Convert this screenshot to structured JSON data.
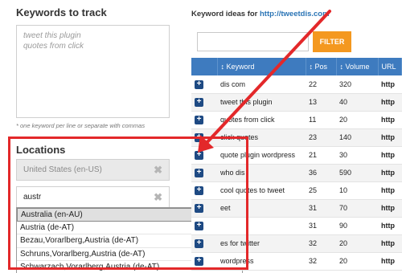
{
  "keywords": {
    "title": "Keywords to track",
    "textarea_value": "tweet this plugin\nquotes from click",
    "hint": "* one keyword per line or separate with commas"
  },
  "locations": {
    "title": "Locations",
    "selected": "United States (en-US)",
    "search_value": "austr",
    "options": [
      "Australia (en-AU)",
      "Austria (de-AT)",
      "Bezau,Vorarlberg,Austria (de-AT)",
      "Schruns,Vorarlberg,Austria (de-AT)",
      "Schwarzach,Vorarlberg,Austria (de-AT)"
    ]
  },
  "ideas": {
    "title_prefix": "Keyword ideas for",
    "site": "http://tweetdis.com",
    "filter_label": "FILTER",
    "columns": [
      "↕ Keyword",
      "↕ Pos",
      "↕ Volume",
      "URL"
    ],
    "rows": [
      {
        "keyword": "dis com",
        "pos": "22",
        "volume": "320",
        "url": "http"
      },
      {
        "keyword": "tweet this plugin",
        "pos": "13",
        "volume": "40",
        "url": "http"
      },
      {
        "keyword": "quotes from click",
        "pos": "11",
        "volume": "20",
        "url": "http"
      },
      {
        "keyword": "click quotes",
        "pos": "23",
        "volume": "140",
        "url": "http"
      },
      {
        "keyword": "quote plugin wordpress",
        "pos": "21",
        "volume": "30",
        "url": "http"
      },
      {
        "keyword": "who dis",
        "pos": "36",
        "volume": "590",
        "url": "http"
      },
      {
        "keyword": "cool quotes to tweet",
        "pos": "25",
        "volume": "10",
        "url": "http"
      },
      {
        "keyword": "eet",
        "pos": "31",
        "volume": "70",
        "url": "http"
      },
      {
        "keyword": "",
        "pos": "31",
        "volume": "90",
        "url": "http"
      },
      {
        "keyword": "es for twitter",
        "pos": "32",
        "volume": "20",
        "url": "http"
      },
      {
        "keyword": "wordpress",
        "pos": "32",
        "volume": "20",
        "url": "http"
      }
    ]
  },
  "colors": {
    "accent_blue": "#3e7bbf",
    "filter_orange": "#f4981f",
    "annotation_red": "#e3282a"
  }
}
